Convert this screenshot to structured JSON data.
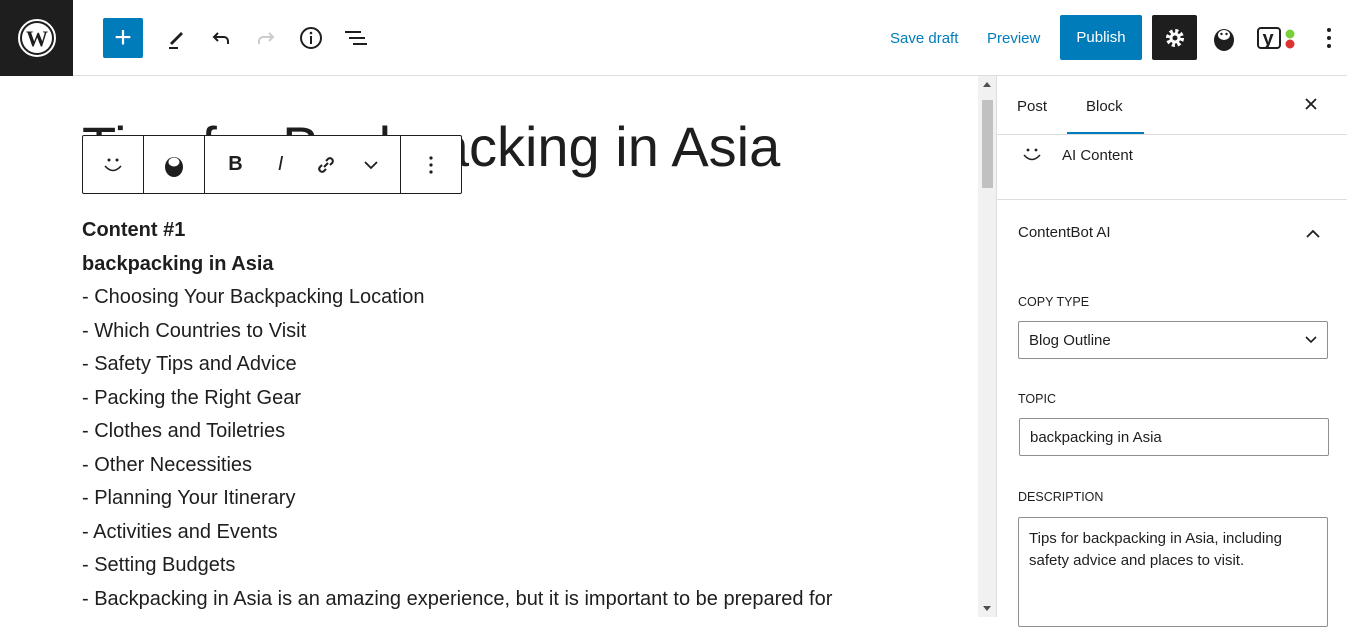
{
  "topbar": {
    "save_draft": "Save draft",
    "preview": "Preview",
    "publish": "Publish"
  },
  "editor": {
    "title": "Tips for Backpacking in Asia",
    "content": [
      "Content #1",
      "backpacking in Asia",
      "- Choosing Your Backpacking Location",
      "- Which Countries to Visit",
      "- Safety Tips and Advice",
      "- Packing the Right Gear",
      "- Clothes and Toiletries",
      "- Other Necessities",
      "- Planning Your Itinerary",
      "- Activities and Events",
      "- Setting Budgets",
      "- Backpacking in Asia is an amazing experience, but it is important to be prepared for"
    ]
  },
  "block_toolbar": {
    "bold": "B",
    "italic": "I"
  },
  "sidebar": {
    "tabs": [
      "Post",
      "Block"
    ],
    "active_tab": "Block",
    "block_name": "AI Content",
    "panel_title": "ContentBot AI",
    "copy_type_label": "COPY TYPE",
    "copy_type_value": "Blog Outline",
    "topic_label": "TOPIC",
    "topic_value": "backpacking in Asia",
    "description_label": "DESCRIPTION",
    "description_value": "Tips for backpacking in Asia, including safety advice and places to visit."
  },
  "colors": {
    "accent": "#007cba",
    "dark": "#1e1e1e"
  }
}
